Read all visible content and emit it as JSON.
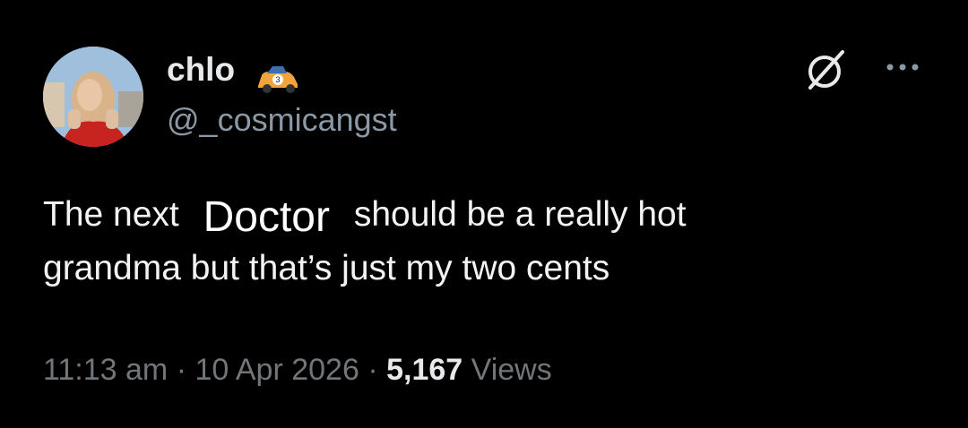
{
  "tweet": {
    "display_name": "chlo",
    "badge_icon": "race-car-emoji",
    "handle": "@_cosmicangst",
    "text_before": "The next",
    "highlighted_word": "Doctor",
    "text_after": "should be a really hot",
    "text_line2": "grandma but that’s just my two cents",
    "time": "11:13 am",
    "separator": "·",
    "date": "10 Apr 2026",
    "views_count": "5,167",
    "views_label": "Views"
  },
  "icons": {
    "grok": "grok-icon",
    "more": "more-options-icon"
  },
  "colors": {
    "background": "#000000",
    "primary_text": "#e7e9ea",
    "secondary_text": "#71767b"
  }
}
